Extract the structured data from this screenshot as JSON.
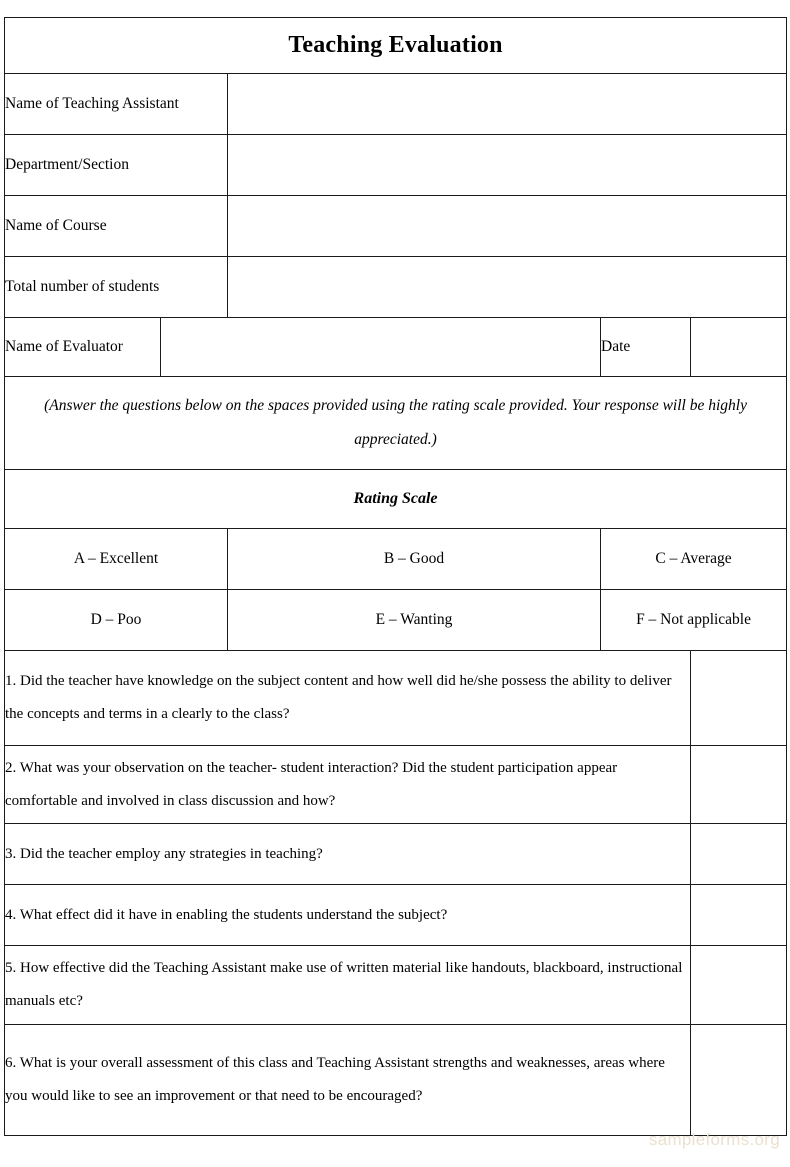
{
  "document": {
    "title": "Teaching Evaluation",
    "watermark": "sampleforms.org"
  },
  "colors": {
    "header_blue": "#9CB8DC",
    "body_blue": "#C9DCF4",
    "field_white": "#FFFFFF",
    "border": "#1B1B1B",
    "watermark": "#ECE0CF"
  },
  "fields": [
    {
      "label": "Name of Teaching Assistant",
      "value": ""
    },
    {
      "label": "Department/Section",
      "value": ""
    },
    {
      "label": "Name of Course",
      "value": ""
    },
    {
      "label": "Total number of students",
      "value": ""
    }
  ],
  "evaluator_row": {
    "name_label": "Name of Evaluator",
    "name_value": "",
    "date_label": "Date",
    "date_value": ""
  },
  "instruction": "(Answer the questions below on the spaces provided using the rating scale provided. Your response will be highly appreciated.)",
  "rating_scale": {
    "heading": "Rating Scale",
    "rows": [
      [
        "A – Excellent",
        "B – Good",
        "C – Average"
      ],
      [
        "D – Poo",
        "E – Wanting",
        "F – Not applicable"
      ]
    ]
  },
  "questions": [
    {
      "text": "1. Did the teacher have knowledge on the subject content and how well did he/she possess the ability to deliver the concepts and terms in a clearly to the class?",
      "answer": ""
    },
    {
      "text": "2. What was your observation on the teacher- student interaction? Did the student participation appear comfortable and involved in class discussion and how?",
      "answer": ""
    },
    {
      "text": "3. Did the teacher employ any strategies in teaching?",
      "answer": ""
    },
    {
      "text": "4. What effect did it have in enabling the students understand the subject?",
      "answer": ""
    },
    {
      "text": "5. How effective did the Teaching Assistant make use of written material like handouts, blackboard, instructional manuals etc?",
      "answer": ""
    },
    {
      "text": "6. What is your overall assessment of this class and Teaching Assistant strengths and weaknesses, areas where you would like to see an improvement or that need to be encouraged?",
      "answer": ""
    }
  ]
}
